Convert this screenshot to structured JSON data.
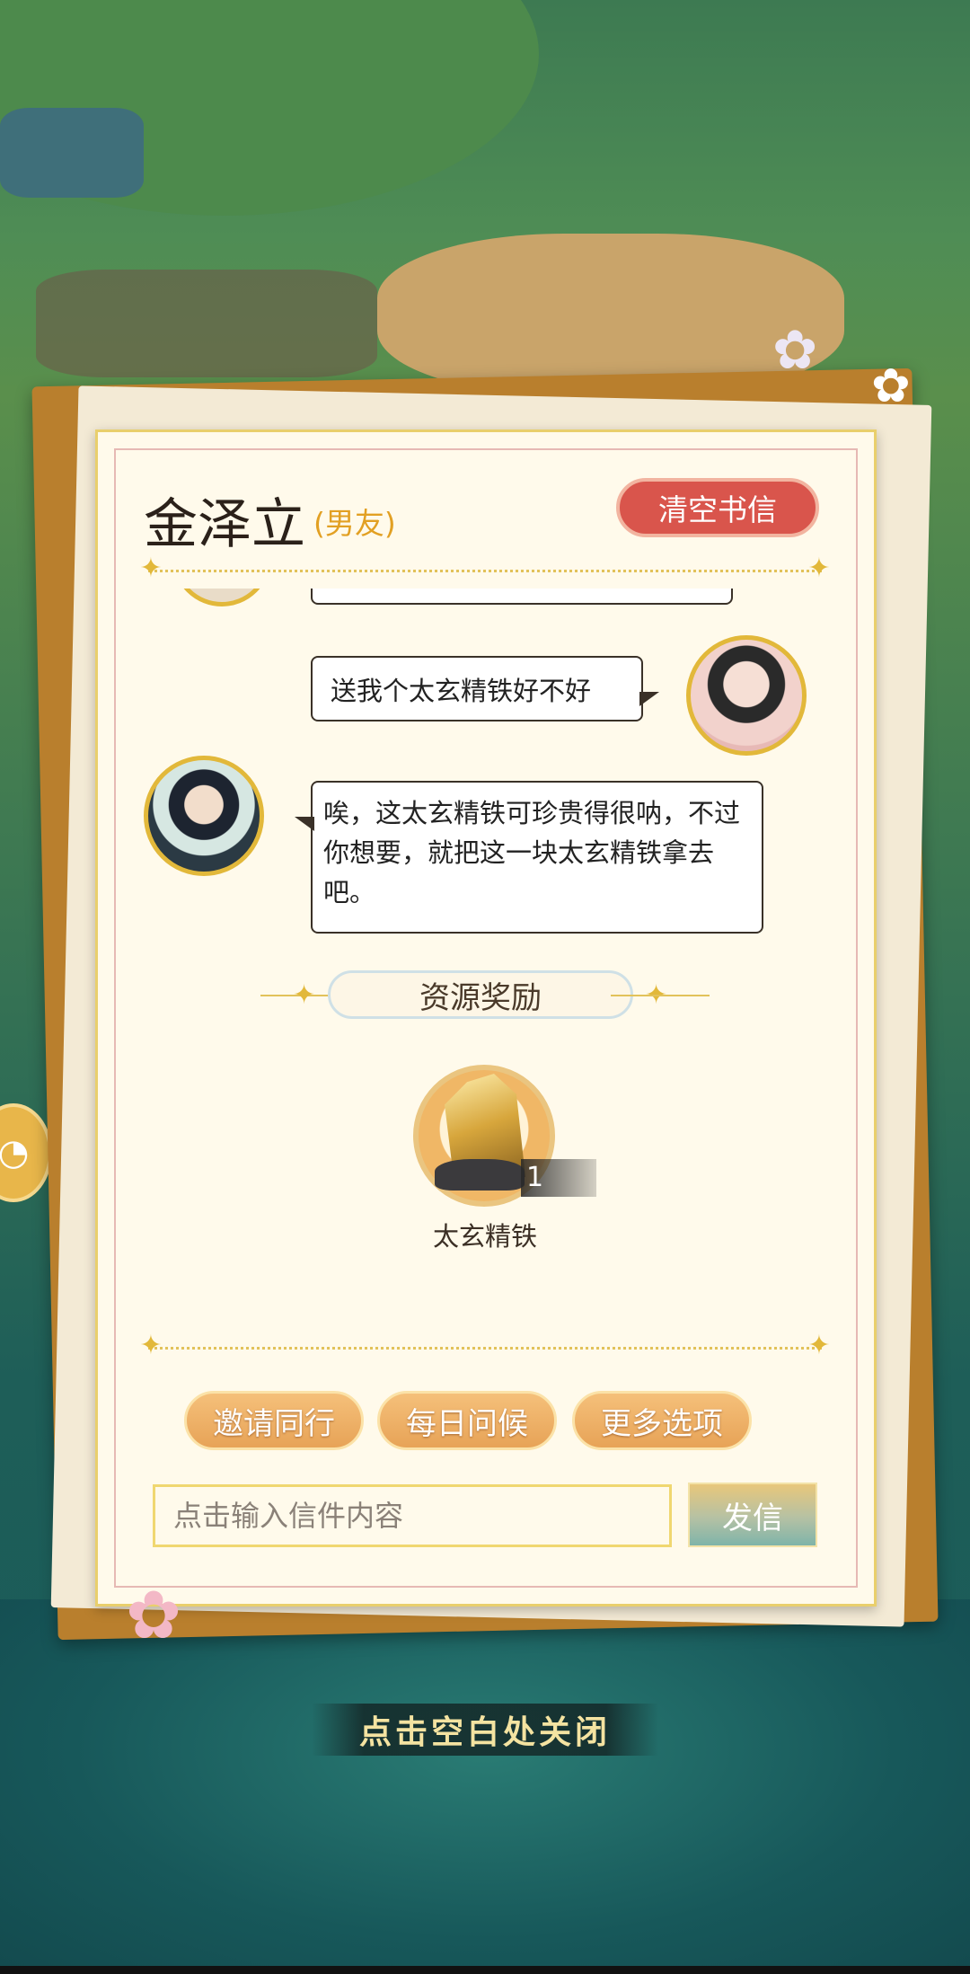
{
  "letter": {
    "contact_name": "金泽立",
    "relationship": "(男友)",
    "clear_button": "清空书信"
  },
  "messages": [
    {
      "sender": "me",
      "text": "送我个太玄精铁好不好"
    },
    {
      "sender": "金泽立",
      "text": "唉，这太玄精铁可珍贵得很呐，不过你想要，就把这一块太玄精铁拿去吧。"
    }
  ],
  "reward": {
    "title": "资源奖励",
    "item_name": "太玄精铁",
    "item_count": "1"
  },
  "actions": {
    "invite": "邀请同行",
    "daily_greeting": "每日问候",
    "more_options": "更多选项"
  },
  "compose": {
    "placeholder": "点击输入信件内容",
    "send_button": "发信"
  },
  "close_hint": "点击空白处关闭",
  "icons": {
    "divider_star": "sparkle-icon",
    "side_button": "chat-bubble-icon"
  }
}
